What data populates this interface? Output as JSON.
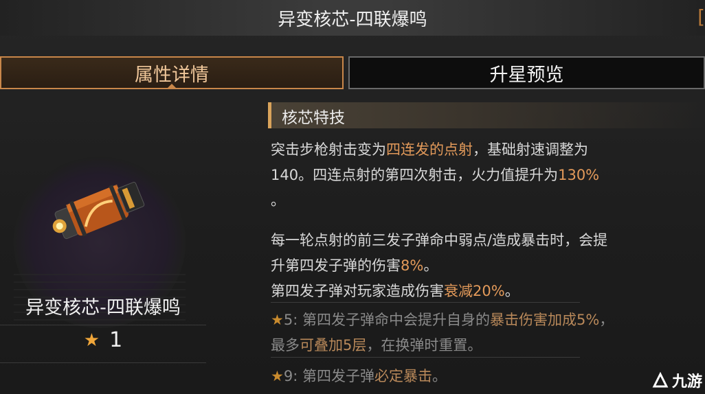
{
  "header": {
    "title": "异变核芯-四联爆鸣",
    "bracket": "["
  },
  "tabs": [
    {
      "label": "属性详情",
      "active": true
    },
    {
      "label": "升星预览",
      "active": false
    }
  ],
  "item": {
    "name": "异变核芯-四联爆鸣",
    "stars": "1",
    "icon": "core-canister-icon"
  },
  "skill": {
    "title": "核芯特技",
    "p1_a": "突击步枪射击变为",
    "p1_hl": "四连发的点射",
    "p1_b": "，基础射速调整为",
    "p1_line2_a": "140。四连点射的第四次射击，火力值提升为",
    "p1_line2_hl": "130%",
    "p1_line3": "。",
    "p2_a": "每一轮点射的前三发子弹命中弱点/造成暴击时，会提",
    "p2_b": "升第四发子弹的伤害",
    "p2_hl": "8%",
    "p2_c": "。",
    "p3_a": "第四发子弹对玩家造成伤害",
    "p3_hl": "衰减20%",
    "p3_b": "。",
    "s5_prefix": "5: 第四发子弹命中会提升自身的",
    "s5_hl": "暴击伤害加成5%",
    "s5_b": "，",
    "s5_line2_a": "最多",
    "s5_line2_hl": "可叠加5层",
    "s5_line2_b": "，在换弹时重置。",
    "s9_prefix": "9: 第四发子弹",
    "s9_hl": "必定暴击",
    "s9_b": "。"
  },
  "watermark": {
    "text": "九游"
  },
  "colors": {
    "accent": "#c9874a",
    "highlight": "#e39a5a",
    "star": "#f0a63a"
  }
}
